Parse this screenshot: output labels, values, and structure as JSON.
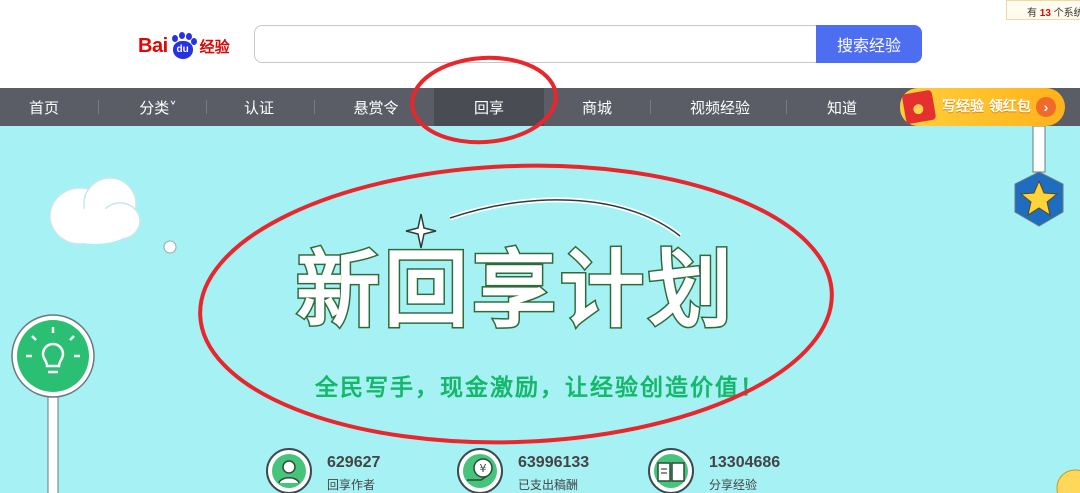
{
  "header": {
    "logo_text_bai": "Bai",
    "logo_text_du": "du",
    "logo_text_product": "经验",
    "search": {
      "value": "",
      "placeholder": ""
    },
    "search_button_label": "搜索经验",
    "notice": {
      "prefix": "有",
      "count": "13",
      "suffix": "个系统"
    }
  },
  "nav": {
    "items": [
      {
        "label": "首页"
      },
      {
        "label": "分类˅"
      },
      {
        "label": "认证"
      },
      {
        "label": "悬赏令"
      },
      {
        "label": "回享",
        "active": true
      },
      {
        "label": "商城"
      },
      {
        "label": "视频经验"
      },
      {
        "label": "知道"
      }
    ],
    "promo": {
      "label": "写经验 领红包",
      "arrow": "›"
    }
  },
  "banner": {
    "title": "新回享计划",
    "slogan": "全民写手，现金激励，让经验创造价值！",
    "stats": [
      {
        "value": "629627",
        "label": "回享作者",
        "icon": "author-icon"
      },
      {
        "value": "63996133",
        "label": "已支出稿酬",
        "icon": "yuan-coin-icon"
      },
      {
        "value": "13304686",
        "label": "分享经验",
        "icon": "book-icon"
      }
    ],
    "bulb_icon": "lightbulb-icon",
    "star_icon": "star-icon"
  },
  "colors": {
    "brand_red": "#e10601",
    "brand_blue": "#2932e1",
    "search_button": "#4e6ef2",
    "nav_background": "#5b5d66",
    "banner_background": "#a6f1f4",
    "slogan_green": "#15b86a",
    "annotation_red": "#e8262b"
  }
}
